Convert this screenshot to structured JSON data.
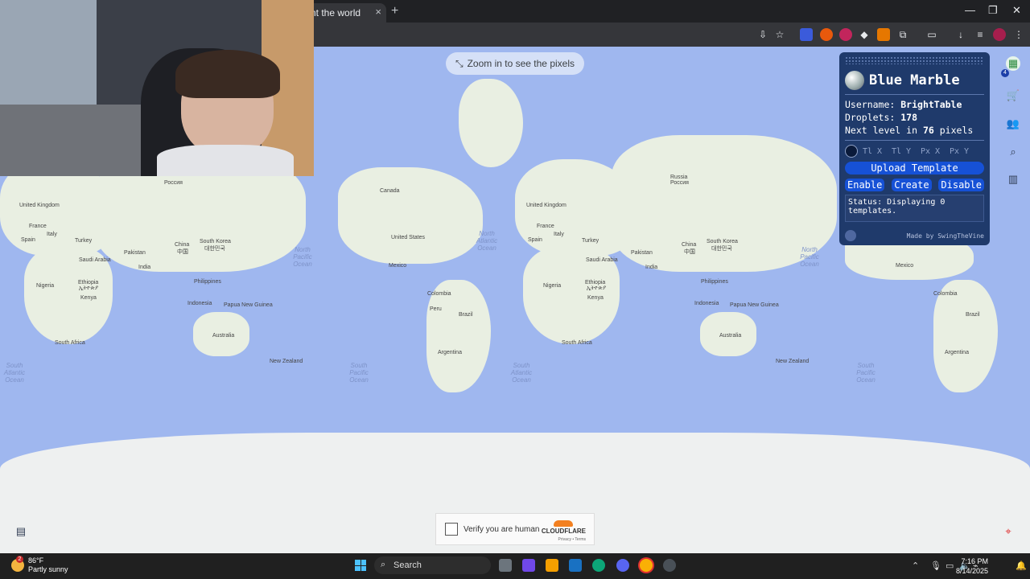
{
  "browser": {
    "tab_title": "nt the world",
    "tab_close": "×",
    "new_tab": "+",
    "window_controls": [
      "—",
      "❐",
      "✕"
    ]
  },
  "map": {
    "zoom_hint": "Zoom in to see the pixels",
    "labels": [
      "United Kingdom",
      "France",
      "Spain",
      "Italy",
      "Turkey",
      "Russia",
      "Россия",
      "China",
      "中国",
      "South Korea",
      "대한민국",
      "Pakistan",
      "Saudi Arabia",
      "India",
      "Nigeria",
      "Ethiopia",
      "ኢትዮጵያ",
      "Kenya",
      "Philippines",
      "Indonesia",
      "Papua New Guinea",
      "Australia",
      "South Africa",
      "New Zealand",
      "Canada",
      "United States",
      "Mexico",
      "Colombia",
      "Peru",
      "Brazil",
      "Argentina"
    ],
    "oceans": [
      "North Atlantic Ocean",
      "North Pacific Ocean",
      "South Atlantic Ocean",
      "South Pacific Ocean"
    ]
  },
  "blue_marble": {
    "title": "Blue Marble",
    "username_label": "Username:",
    "username": "BrightTable",
    "droplets_label": "Droplets:",
    "droplets": "178",
    "next_level_prefix": "Next level in",
    "next_level_value": "76",
    "next_level_suffix": "pixels",
    "coord_placeholders": [
      "Tl X",
      "Tl Y",
      "Px X",
      "Px Y"
    ],
    "upload_button": "Upload Template",
    "enable_button": "Enable",
    "create_button": "Create",
    "disable_button": "Disable",
    "status": "Status: Displaying 0 templates.",
    "footer": "Made by SwingTheVine"
  },
  "sidebar": {
    "badge": "4",
    "icons": [
      "cart-icon",
      "group-icon",
      "search-icon",
      "leaderboard-icon"
    ]
  },
  "captcha": {
    "label": "Verify you are human",
    "brand": "CLOUDFLARE",
    "links": "Privacy • Terms"
  },
  "taskbar": {
    "temperature": "86°F",
    "weather": "Partly sunny",
    "weather_badge": "2",
    "search": "Search",
    "time": "7:16 PM",
    "date": "8/14/2025"
  },
  "colors": {
    "ocean": "#9fb7ef",
    "land": "#e9efe2",
    "panel": "#1f3a6b",
    "button": "#1651d6"
  }
}
